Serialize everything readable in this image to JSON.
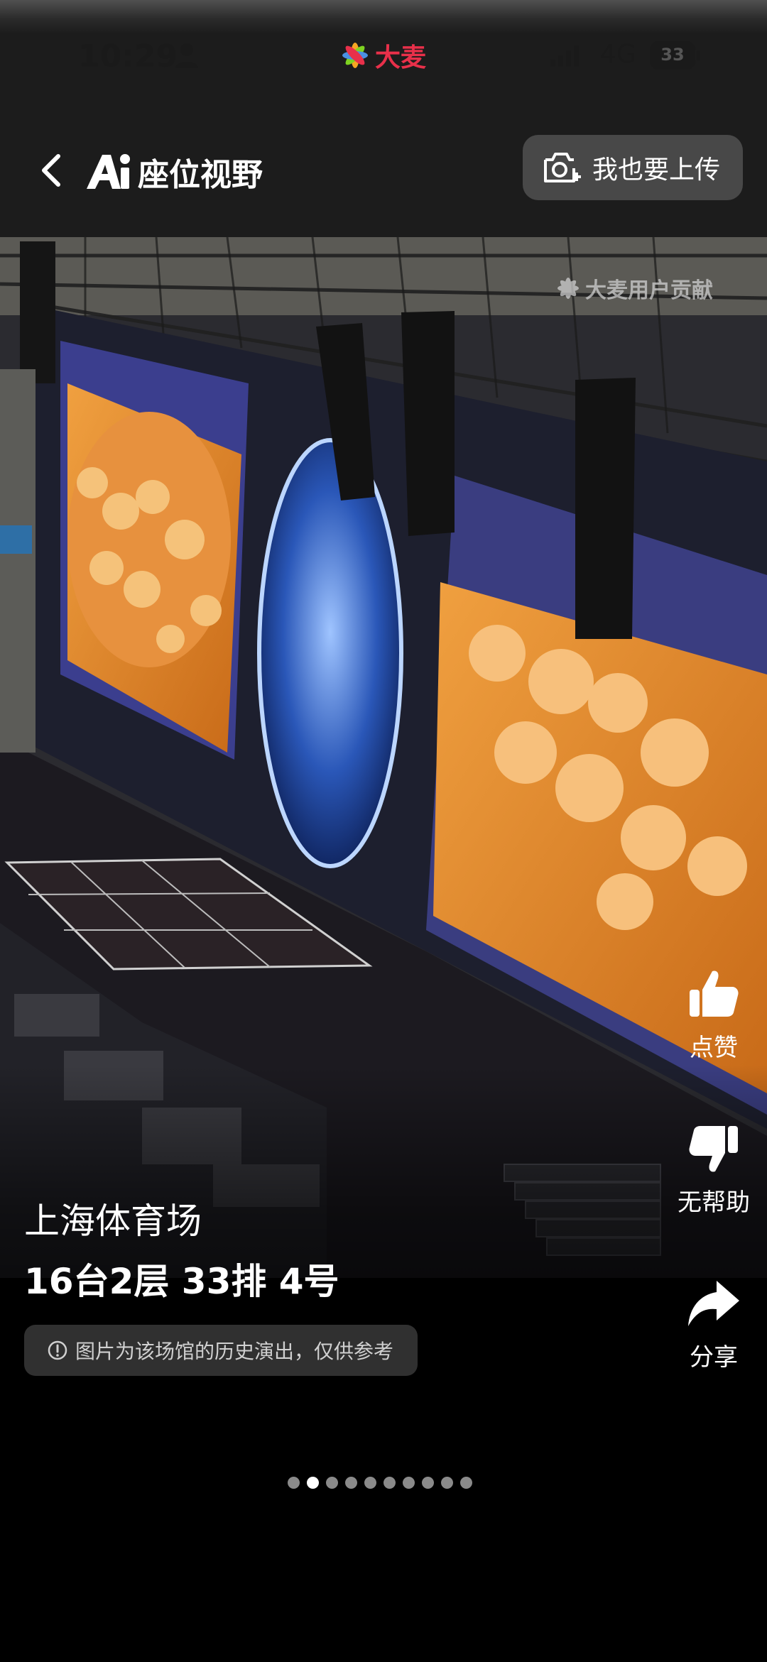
{
  "status_bar": {
    "time": "10:29",
    "app_name": "大麦",
    "network": "4G",
    "battery": "33"
  },
  "header": {
    "title": "座位视野",
    "upload_label": "我也要上传"
  },
  "photo": {
    "watermark": "大麦用户贡献"
  },
  "actions": {
    "like_label": "点赞",
    "unhelpful_label": "无帮助",
    "share_label": "分享"
  },
  "info": {
    "venue": "上海体育场",
    "seat": "16台2层 33排 4号",
    "disclaimer": "图片为该场馆的历史演出，仅供参考"
  },
  "pager": {
    "count": 10,
    "active_index": 1
  },
  "icons": {
    "back": "chevron-left-icon",
    "ai_logo": "ai-logo-icon",
    "upload": "camera-plus-icon",
    "like": "thumbs-up-icon",
    "unhelpful": "thumbs-down-icon",
    "share": "share-arrow-icon",
    "info": "info-circle-icon"
  }
}
